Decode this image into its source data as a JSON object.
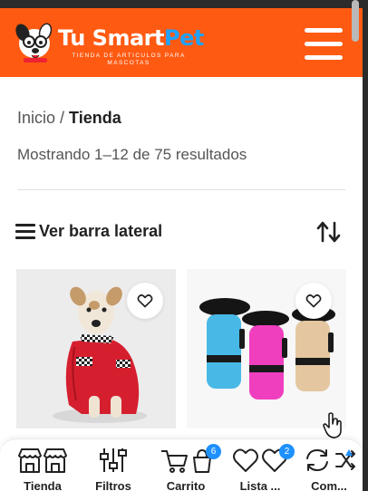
{
  "brand": {
    "name_part1": "Tu Smart",
    "name_part2": "Pet",
    "tagline": "TIENDA DE ARTICULOS PARA MASCOTAS",
    "header_color": "#ff5a12",
    "accent_color": "#1ea3ff"
  },
  "header": {
    "menu_icon": "hamburger-menu-icon"
  },
  "breadcrumb": {
    "home": "Inicio",
    "separator": "/",
    "current": "Tienda"
  },
  "results_text": "Mostrando 1–12 de 75 resultados",
  "toolbar": {
    "sidebar_label": "Ver barra lateral",
    "sidebar_icon": "list-icon",
    "sort_icon": "sort-arrows-icon"
  },
  "products": [
    {
      "image": "dog in red raincoat",
      "wishlist_icon": "heart-icon"
    },
    {
      "image": "pet water bottles",
      "wishlist_icon": "heart-icon"
    }
  ],
  "bottom_nav": {
    "items": [
      {
        "label": "Tienda",
        "icon": "store-icon"
      },
      {
        "label": "Filtros",
        "icon": "filter-sliders-icon"
      },
      {
        "label": "Carrito",
        "icon": "cart-icon",
        "badge": "6"
      },
      {
        "label": "Lista ...",
        "icon": "heart-icon",
        "badge": "2"
      },
      {
        "label": "Com...",
        "icon": "compare-icon"
      }
    ]
  }
}
